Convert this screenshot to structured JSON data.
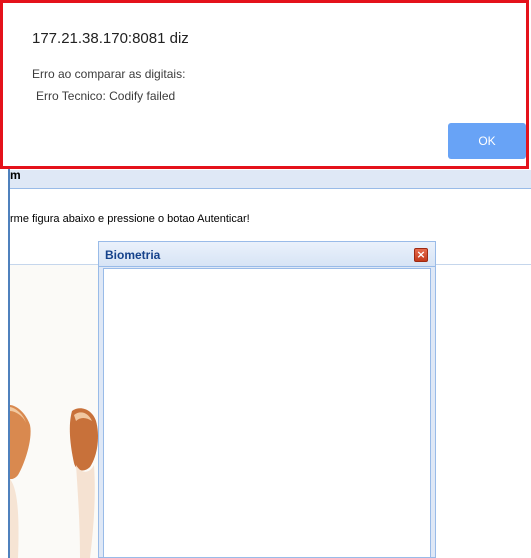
{
  "alert": {
    "origin": "177.21.38.170:8081 diz",
    "message_line1": "Erro ao comparar as digitais:",
    "message_line2": "Erro Tecnico: Codify failed",
    "ok_label": "OK",
    "border_color": "#e4121b",
    "button_color": "#68a3f6"
  },
  "page": {
    "header_fragment": "m",
    "instruction": "rme figura abaixo e pressione o botao Autenticar!"
  },
  "biometria_window": {
    "title": "Biometria",
    "close_icon": "close-icon"
  }
}
